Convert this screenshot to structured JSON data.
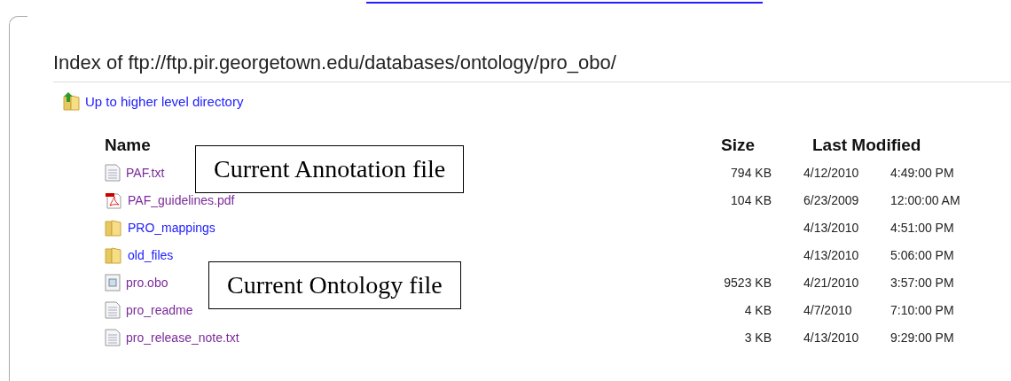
{
  "title": "Index of ftp://ftp.pir.georgetown.edu/databases/ontology/pro_obo/",
  "up_link": "Up to higher level directory",
  "columns": {
    "name": "Name",
    "size": "Size",
    "modified": "Last Modified"
  },
  "files": [
    {
      "name": "PAF.txt",
      "kind": "text",
      "visited": true,
      "size": "794 KB",
      "date": "4/12/2010",
      "time": "4:49:00 PM"
    },
    {
      "name": "PAF_guidelines.pdf",
      "kind": "pdf",
      "visited": true,
      "size": "104 KB",
      "date": "6/23/2009",
      "time": "12:00:00 AM"
    },
    {
      "name": "PRO_mappings",
      "kind": "folder",
      "visited": false,
      "date": "4/13/2010",
      "time": "4:51:00 PM"
    },
    {
      "name": "old_files",
      "kind": "folder",
      "visited": false,
      "date": "4/13/2010",
      "time": "5:06:00 PM"
    },
    {
      "name": "pro.obo",
      "kind": "obo",
      "visited": true,
      "size": "9523 KB",
      "date": "4/21/2010",
      "time": "3:57:00 PM"
    },
    {
      "name": "pro_readme",
      "kind": "text",
      "visited": true,
      "size": "4 KB",
      "date": "4/7/2010",
      "time": "7:10:00 PM"
    },
    {
      "name": "pro_release_note.txt",
      "kind": "text",
      "visited": true,
      "size": "3 KB",
      "date": "4/13/2010",
      "time": "9:29:00 PM"
    }
  ],
  "callouts": [
    {
      "text": "Current Annotation file"
    },
    {
      "text": "Current Ontology file"
    }
  ]
}
